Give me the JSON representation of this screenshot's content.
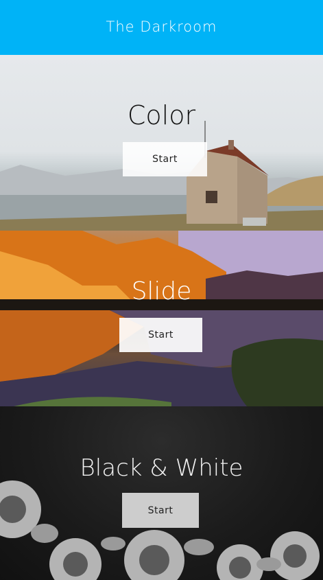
{
  "header": {
    "title": "The Darkroom",
    "color": "#00b3f7"
  },
  "sections": [
    {
      "label": "Color",
      "button_label": "Start"
    },
    {
      "label": "Slide",
      "button_label": "Start"
    },
    {
      "label": "Black & White",
      "button_label": "Start"
    }
  ]
}
